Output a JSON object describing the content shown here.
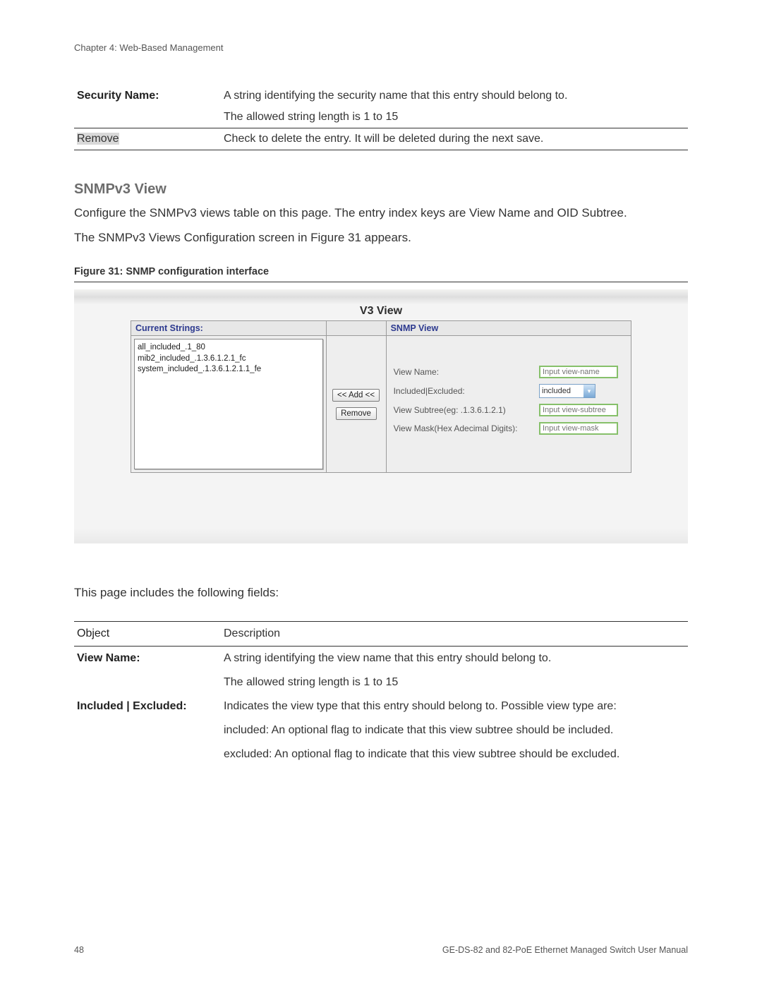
{
  "chapter_header": "Chapter 4: Web-Based Management",
  "top_table": {
    "security_name_label": "Security Name:",
    "security_name_desc1": "A string identifying the security name that this entry should belong to.",
    "security_name_desc2": "The allowed string length is 1 to 15",
    "remove_label": "Remove",
    "remove_desc": "Check to delete the entry. It will be deleted during the next save."
  },
  "section_title": "SNMPv3 View",
  "para1": "Configure the SNMPv3 views table on this page. The entry index keys are View Name and OID Subtree.",
  "para2": "The SNMPv3 Views Configuration screen in Figure 31 appears.",
  "figure_caption": "Figure 31: SNMP configuration interface",
  "shot": {
    "title": "V3 View",
    "left_header": "Current Strings:",
    "right_header": "SNMP View",
    "listbox_items": [
      "all_included_.1_80",
      "mib2_included_.1.3.6.1.2.1_fc",
      "system_included_.1.3.6.1.2.1.1_fe"
    ],
    "btn_add": "<< Add <<",
    "btn_remove": "Remove",
    "form": {
      "view_name_label": "View Name:",
      "view_name_placeholder": "Input view-name",
      "included_label": "Included|Excluded:",
      "included_value": "included",
      "subtree_label": "View Subtree(eg: .1.3.6.1.2.1)",
      "subtree_placeholder": "Input view-subtree",
      "mask_label": "View Mask(Hex Adecimal Digits):",
      "mask_placeholder": "Input view-mask"
    }
  },
  "fields_intro": "This page includes the following fields:",
  "fields_table": {
    "h_object": "Object",
    "h_desc": "Description",
    "view_name_label": "View Name:",
    "view_name_d1": "A string identifying the view name that this entry should belong to.",
    "view_name_d2": "The allowed string length is 1 to 15",
    "incl_label": "Included | Excluded:",
    "incl_d1": "Indicates the view type that this entry should belong to. Possible view type are:",
    "incl_d2": "included: An optional flag to indicate that this view subtree should be included.",
    "incl_d3": "excluded: An optional flag to indicate that this view subtree should be excluded."
  },
  "footer": {
    "page": "48",
    "manual": "GE-DS-82 and 82-PoE Ethernet Managed Switch User Manual"
  }
}
